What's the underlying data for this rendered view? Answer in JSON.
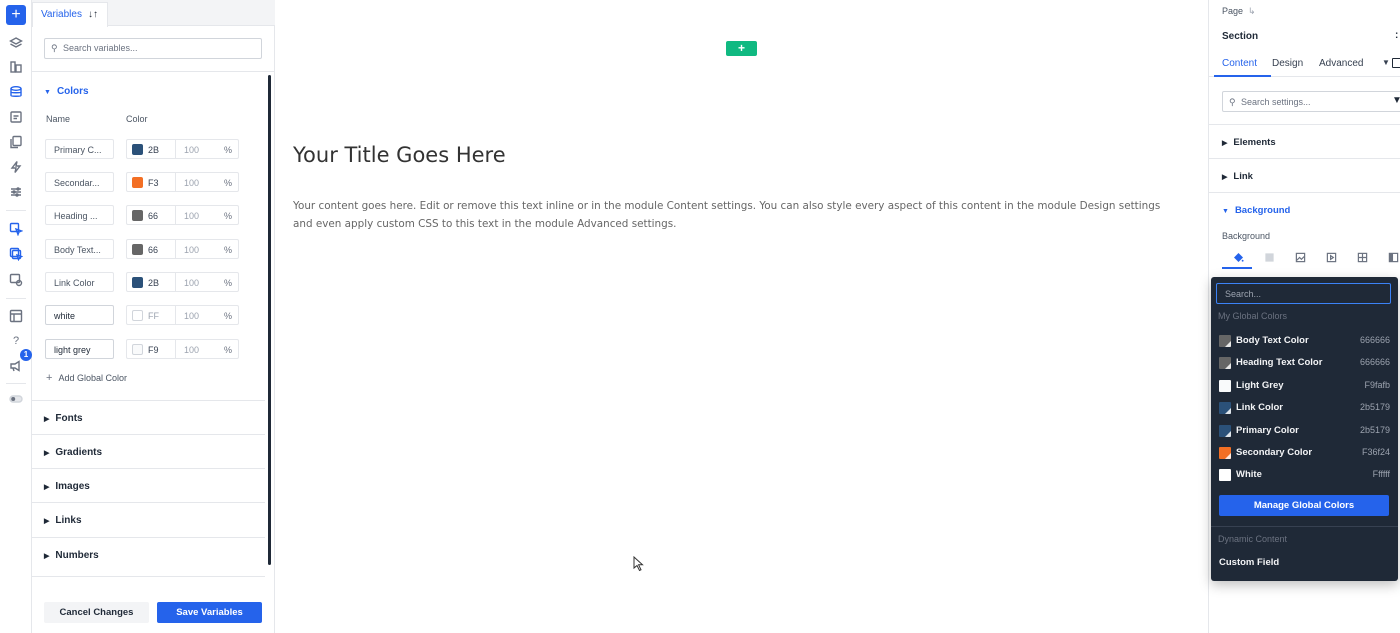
{
  "variables_panel": {
    "tab_label": "Variables",
    "search_placeholder": "Search variables...",
    "colors_section": "Colors",
    "col_name": "Name",
    "col_color": "Color",
    "rows": [
      {
        "name": "Primary C...",
        "hex": "2B",
        "color": "#2b5179",
        "opacity": "100",
        "unit": "%"
      },
      {
        "name": "Secondar...",
        "hex": "F3",
        "color": "#f36f24",
        "opacity": "100",
        "unit": "%"
      },
      {
        "name": "Heading ...",
        "hex": "66",
        "color": "#666666",
        "opacity": "100",
        "unit": "%"
      },
      {
        "name": "Body Text...",
        "hex": "66",
        "color": "#666666",
        "opacity": "100",
        "unit": "%"
      },
      {
        "name": "Link Color",
        "hex": "2B",
        "color": "#2b5179",
        "opacity": "100",
        "unit": "%"
      },
      {
        "name": "white",
        "hex": "FF",
        "color": "#ffffff",
        "opacity": "100",
        "unit": "%"
      },
      {
        "name": "light grey",
        "hex": "F9",
        "color": "#f9fafb",
        "opacity": "100",
        "unit": "%"
      }
    ],
    "add_global_color": "Add Global Color",
    "sections": [
      "Fonts",
      "Gradients",
      "Images",
      "Links",
      "Numbers"
    ],
    "cancel_label": "Cancel Changes",
    "save_label": "Save Variables"
  },
  "canvas": {
    "add_section_label": "+",
    "title": "Your Title Goes Here",
    "body": "Your content goes here. Edit or remove this text inline or in the module Content settings. You can also style every aspect of this content in the module Design settings and even apply custom CSS to this text in the module Advanced settings."
  },
  "settings_panel": {
    "breadcrumb": "Page",
    "section_title": "Section",
    "more_label": ":",
    "tabs": [
      "Content",
      "Design",
      "Advanced"
    ],
    "search_placeholder": "Search settings...",
    "accordions": [
      "Elements",
      "Link",
      "Background"
    ],
    "background_label": "Background"
  },
  "global_colors": {
    "search_placeholder": "Search...",
    "section_label": "My Global Colors",
    "items": [
      {
        "name": "Body Text Color",
        "hex": "666666",
        "color": "#666666"
      },
      {
        "name": "Heading Text Color",
        "hex": "666666",
        "color": "#666666"
      },
      {
        "name": "Light Grey",
        "hex": "F9fafb",
        "color": "#f9fafb"
      },
      {
        "name": "Link Color",
        "hex": "2b5179",
        "color": "#2b5179"
      },
      {
        "name": "Primary Color",
        "hex": "2b5179",
        "color": "#2b5179"
      },
      {
        "name": "Secondary Color",
        "hex": "F36f24",
        "color": "#f36f24"
      },
      {
        "name": "White",
        "hex": "Ffffff",
        "color": "#ffffff"
      }
    ],
    "manage_label": "Manage Global Colors",
    "dynamic_label": "Dynamic Content",
    "custom_field_label": "Custom Field"
  },
  "rail": {
    "add_label": "+",
    "help_label": "?",
    "notification_count": "1"
  },
  "theme": {
    "accent": "#2563eb",
    "add_section": "#10b981",
    "dropdown_bg": "#1f2937"
  }
}
